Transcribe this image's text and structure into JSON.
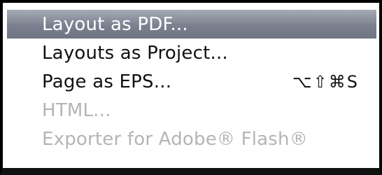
{
  "menu": {
    "items": [
      {
        "label": "Layout as PDF...",
        "state": "highlighted",
        "shortcut": ""
      },
      {
        "label": "Layouts as Project...",
        "state": "enabled",
        "shortcut": ""
      },
      {
        "label": "Page as EPS...",
        "state": "enabled",
        "shortcut": "⌥⇧⌘S"
      },
      {
        "label": "HTML...",
        "state": "disabled",
        "shortcut": ""
      },
      {
        "label": "Exporter for Adobe® Flash®",
        "state": "disabled",
        "shortcut": ""
      }
    ]
  },
  "colors": {
    "highlight_top": "#a6abb6",
    "highlight_bottom": "#6e7483",
    "enabled_text": "#111111",
    "disabled_text": "#b5b5b5",
    "highlighted_text": "#ffffff"
  }
}
